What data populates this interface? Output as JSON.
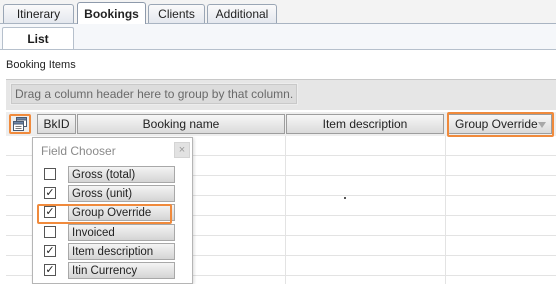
{
  "tabs": [
    {
      "label": "Itinerary",
      "active": false
    },
    {
      "label": "Bookings",
      "active": true
    },
    {
      "label": "Clients",
      "active": false
    },
    {
      "label": "Additional",
      "active": false
    }
  ],
  "subtab": {
    "label": "List"
  },
  "section_label": "Booking Items",
  "group_panel": {
    "prompt": "Drag a column header here to group by that column."
  },
  "columns": {
    "bkid": "BkID",
    "booking_name": "Booking name",
    "item_description": "Item description",
    "group_override": "Group Override"
  },
  "field_chooser": {
    "title": "Field Chooser",
    "close_label": "×",
    "items": [
      {
        "label": "Gross (total)",
        "checked": false
      },
      {
        "label": "Gross (unit)",
        "checked": true
      },
      {
        "label": "Group Override",
        "checked": true
      },
      {
        "label": "Invoiced",
        "checked": false
      },
      {
        "label": "Item description",
        "checked": true
      },
      {
        "label": "Itin Currency",
        "checked": true
      }
    ]
  },
  "icons": {
    "field_chooser_button": "field-chooser-icon",
    "sort_indicator": "filter-arrow-icon"
  },
  "colors": {
    "highlight": "#f08a3c"
  }
}
